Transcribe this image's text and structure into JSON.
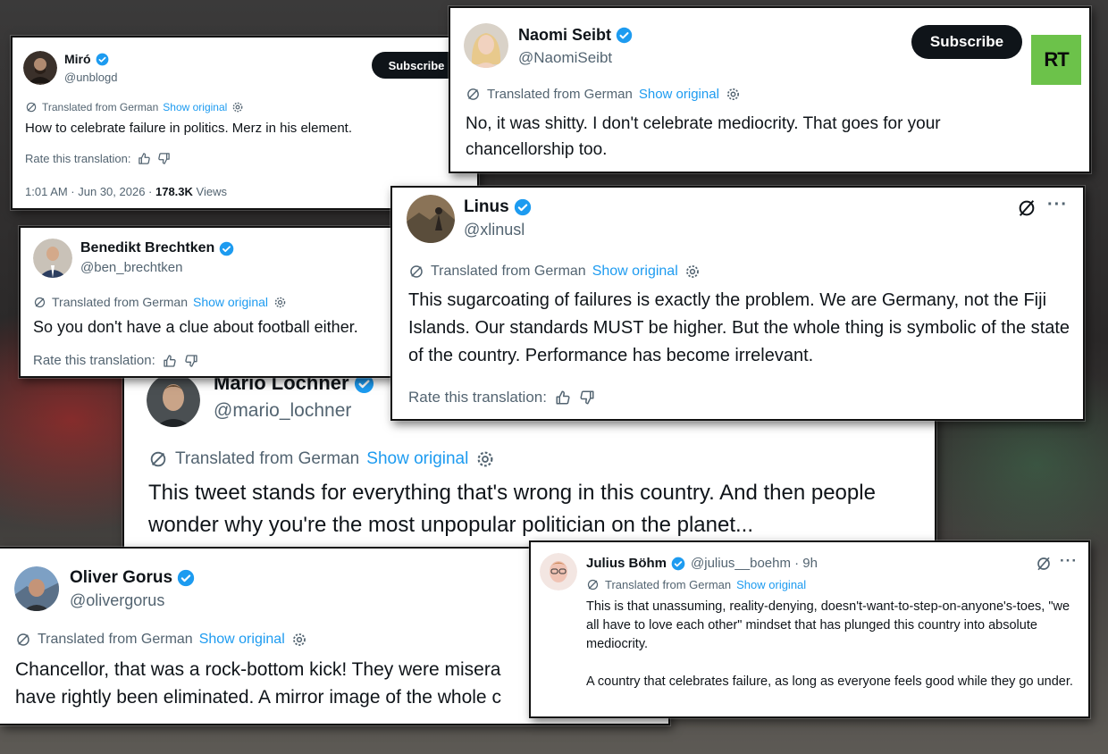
{
  "translated_label": "Translated from German",
  "show_original_label": "Show original",
  "rate_label": "Rate this translation:",
  "subscribe_label": "Subscribe",
  "colors": {
    "verified": "#1d9bf0",
    "link": "#1d9bf0",
    "rt_logo_bg": "#6cc24a"
  },
  "tweets": {
    "miro": {
      "name": "Miró",
      "handle": "@unblogd",
      "text": "How to celebrate failure in politics. Merz in his element.",
      "timestamp": "1:01 AM · Jun 30, 2026 · ",
      "views_count": "178.3K",
      "views_label": " Views"
    },
    "naomi": {
      "name": "Naomi Seibt",
      "handle": "@NaomiSeibt",
      "text": "No, it was shitty. I don't celebrate mediocrity. That goes for your chancellorship too.",
      "logo_text": "RT"
    },
    "benedikt": {
      "name": "Benedikt Brechtken",
      "handle": "@ben_brechtken",
      "text": "So you don't have a clue about football either."
    },
    "linus": {
      "name": "Linus",
      "handle": "@xlinusl",
      "text": "This sugarcoating of failures is exactly the problem. We are Germany, not the Fiji Islands. Our standards MUST be higher. But the whole thing is symbolic of the state of the country. Performance has become irrelevant."
    },
    "mario": {
      "name": "Mario Lochner",
      "handle": "@mario_lochner",
      "text": "This tweet stands for everything that's wrong in this country. And then people wonder why you're the most unpopular politician on the planet..."
    },
    "oliver": {
      "name": "Oliver Gorus",
      "handle": "@olivergorus",
      "text_line1": "Chancellor, that was a rock-bottom kick! They were misera",
      "text_line2": "have rightly been eliminated. A mirror image of the whole c"
    },
    "julius": {
      "name": "Julius Böhm",
      "handle_time": "@julius__boehm · 9h",
      "text_p1": "This is that unassuming, reality-denying, doesn't-want-to-step-on-anyone's-toes, \"we all have to love each other\" mindset that has plunged this country into absolute mediocrity.",
      "text_p2": "A country that celebrates failure, as long as everyone feels good while they go under."
    }
  }
}
